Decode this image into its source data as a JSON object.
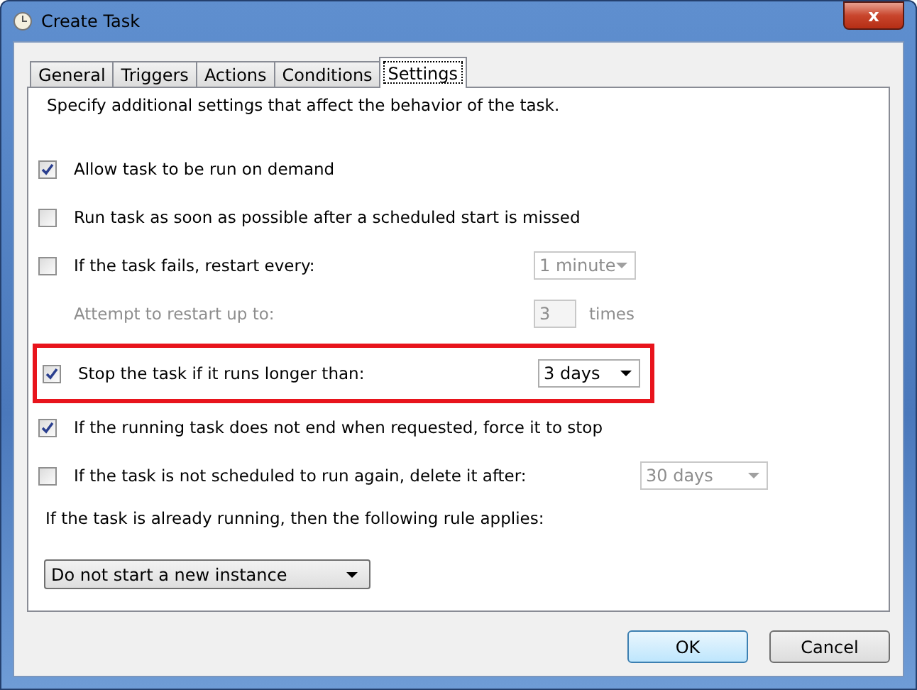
{
  "window": {
    "title": "Create Task",
    "close": "x"
  },
  "tabs": [
    {
      "label": "General",
      "selected": false
    },
    {
      "label": "Triggers",
      "selected": false
    },
    {
      "label": "Actions",
      "selected": false
    },
    {
      "label": "Conditions",
      "selected": false
    },
    {
      "label": "Settings",
      "selected": true
    }
  ],
  "intro": "Specify additional settings that affect the behavior of the task.",
  "options": [
    {
      "kind": "check",
      "label": "Allow task to be run on demand",
      "checked": true
    },
    {
      "kind": "check",
      "label": "Run task as soon as possible after a scheduled start is missed",
      "checked": false
    },
    {
      "kind": "check-select",
      "label": "If the task fails, restart every:",
      "checked": false,
      "select": {
        "value": "1 minute",
        "disabled": true
      }
    },
    {
      "kind": "number",
      "label": "Attempt to restart up to:",
      "disabled": true,
      "value": "3",
      "unit": "times"
    },
    {
      "kind": "check-select",
      "label": "Stop the task if it runs longer than:",
      "checked": true,
      "highlighted": true,
      "select": {
        "value": "3 days",
        "disabled": false
      }
    },
    {
      "kind": "check",
      "label": "If the running task does not end when requested, force it to stop",
      "checked": true
    },
    {
      "kind": "check-select-far",
      "label": "If the task is not scheduled to run again, delete it after:",
      "checked": false,
      "select": {
        "value": "30 days",
        "disabled": true
      }
    }
  ],
  "rule": {
    "label": "If the task is already running, then the following rule applies:",
    "value": "Do not start a new instance"
  },
  "buttons": [
    {
      "label": "OK",
      "default": true
    },
    {
      "label": "Cancel",
      "default": false
    }
  ]
}
